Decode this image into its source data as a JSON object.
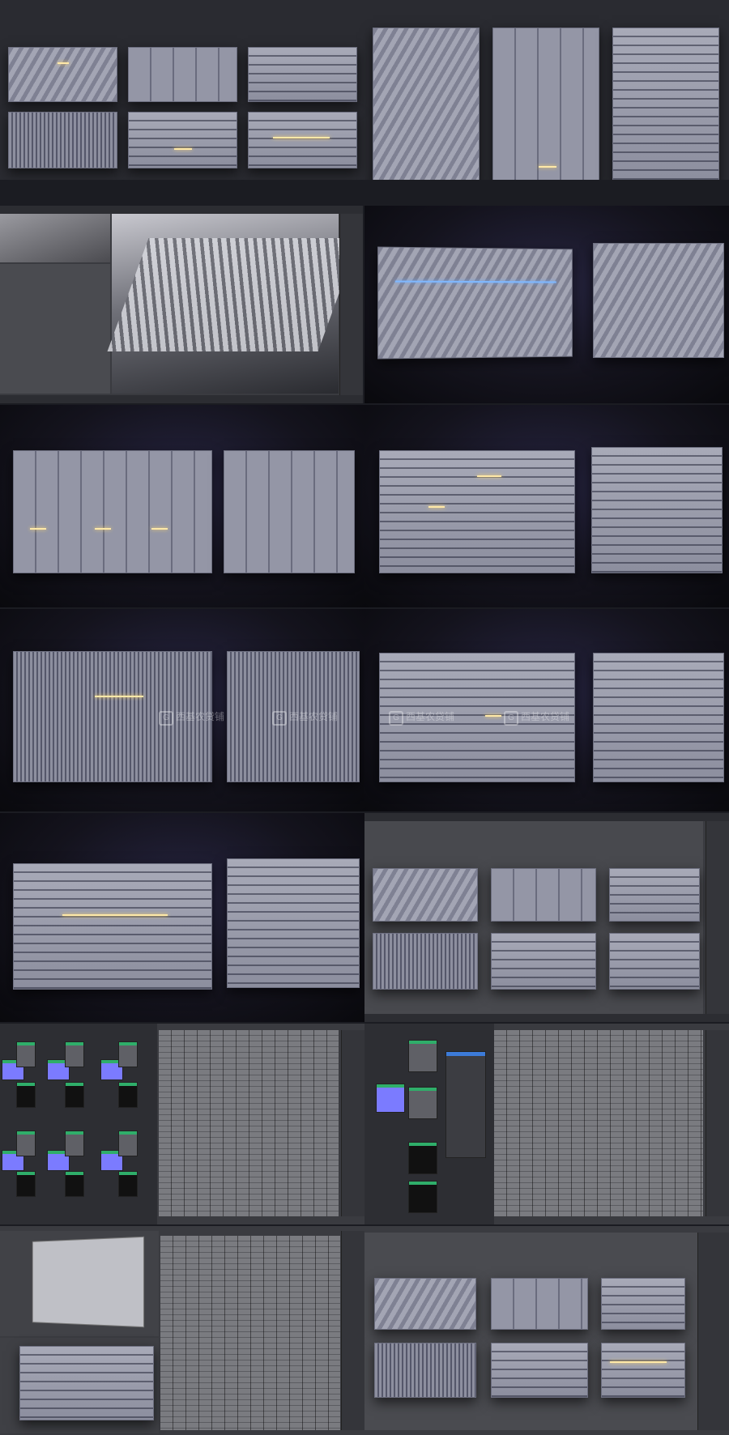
{
  "watermark": {
    "brand": "西基农贷铺",
    "sub": "CGjoy.com"
  },
  "colors": {
    "background": "#1b1c22",
    "node_header": "#2fae6a",
    "panel_base": "#9496a6",
    "light": "#ffe9a8",
    "accent_blue": "#7fb8ff"
  }
}
